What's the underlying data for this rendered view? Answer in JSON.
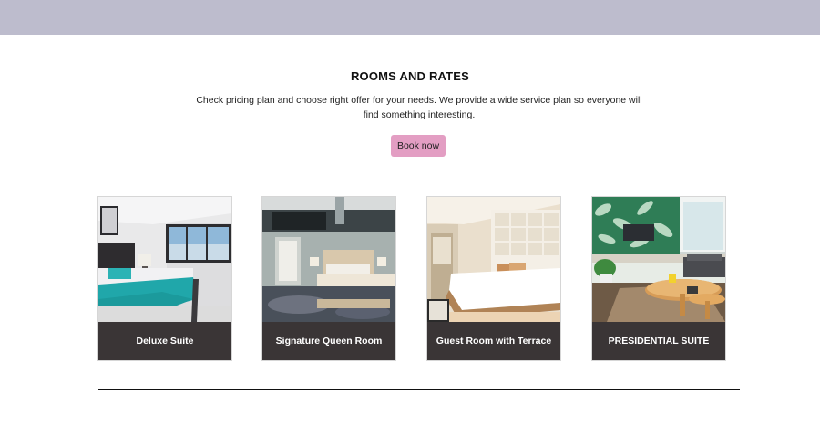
{
  "colors": {
    "topbar": "#bdbccd",
    "accent_button": "#e39ec3",
    "card_label_bg": "#3a3536"
  },
  "section": {
    "title": "ROOMS AND RATES",
    "description": "Check pricing plan and choose right offer for your needs. We provide a wide service plan so everyone will find something interesting.",
    "book_label": "Book now"
  },
  "rooms": [
    {
      "label": "Deluxe Suite",
      "image": "bedroom-white-teal-photo"
    },
    {
      "label": "Signature Queen Room",
      "image": "bedroom-grey-loft-photo"
    },
    {
      "label": "Guest Room with Terrace",
      "image": "bedroom-wood-terrace-photo"
    },
    {
      "label": "PRESIDENTIAL SUITE",
      "image": "lounge-tropical-wallpaper-photo"
    }
  ]
}
